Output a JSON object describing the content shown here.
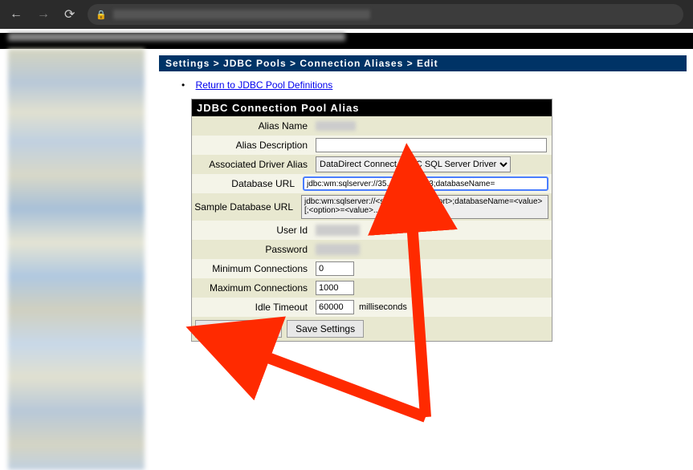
{
  "browser": {
    "url_hidden": true
  },
  "breadcrumb": "Settings > JDBC Pools > Connection Aliases > Edit",
  "return_link": "Return to JDBC Pool Definitions",
  "panel_title": "JDBC Connection Pool Alias",
  "labels": {
    "alias_name": "Alias Name",
    "alias_desc": "Alias Description",
    "driver_alias": "Associated Driver Alias",
    "db_url": "Database URL",
    "sample_url": "Sample Database URL",
    "user_id": "User Id",
    "password": "Password",
    "min_conn": "Minimum Connections",
    "max_conn": "Maximum Connections",
    "idle_timeout": "Idle Timeout"
  },
  "values": {
    "alias_desc": "",
    "driver_alias": "DataDirect Connect JDBC SQL Server Driver",
    "db_url": "jdbc:wm:sqlserver://35.           :1433;databaseName=",
    "sample_url": "jdbc:wm:sqlserver://<server>:<1433|port>;databaseName=<value>[;<option>=<value>...]",
    "min_conn": "0",
    "max_conn": "1000",
    "idle_timeout": "60000"
  },
  "units": {
    "idle_timeout": "milliseconds"
  },
  "buttons": {
    "test": "Test Connection",
    "save": "Save Settings"
  }
}
